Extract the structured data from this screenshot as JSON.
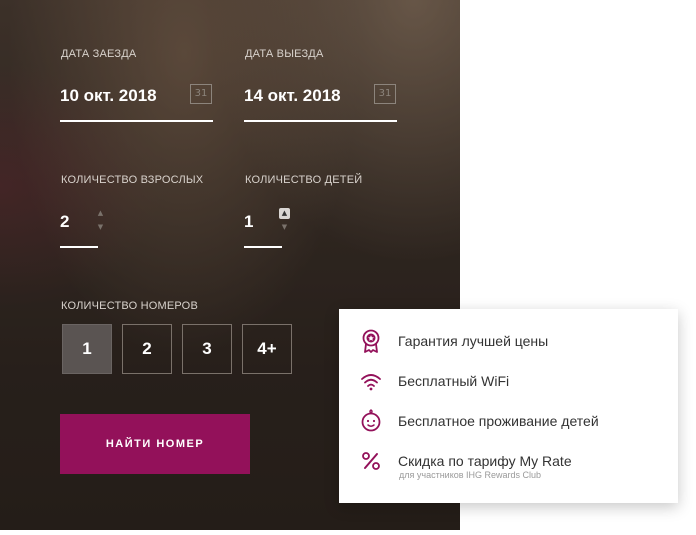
{
  "checkin": {
    "label": "ДАТА ЗАЕЗДА",
    "value": "10 окт. 2018",
    "icon_text": "31",
    "icon": "calendar-icon"
  },
  "checkout": {
    "label": "ДАТА ВЫЕЗДА",
    "value": "14 окт. 2018",
    "icon_text": "31",
    "icon": "calendar-icon"
  },
  "adults": {
    "label": "КОЛИЧЕСТВО ВЗРОСЛЫХ",
    "value": "2"
  },
  "children": {
    "label": "КОЛИЧЕСТВО ДЕТЕЙ",
    "value": "1"
  },
  "rooms": {
    "label": "КОЛИЧЕСТВО НОМЕРОВ",
    "options": [
      "1",
      "2",
      "3",
      "4+"
    ],
    "selected": "1"
  },
  "search_button": {
    "label": "НАЙТИ НОМЕР"
  },
  "benefits": [
    {
      "text": "Гарантия лучшей цены",
      "icon": "award-ribbon-icon"
    },
    {
      "text": "Бесплатный WiFi",
      "icon": "wifi-icon"
    },
    {
      "text": "Бесплатное проживание детей",
      "icon": "baby-icon"
    },
    {
      "text": "Скидка по тарифу My Rate",
      "icon": "percent-icon",
      "subtext": "для участников IHG Rewards Club"
    }
  ],
  "colors": {
    "accent": "#93115a",
    "panel_dark": "#2e2520",
    "card_bg": "#ffffff"
  }
}
